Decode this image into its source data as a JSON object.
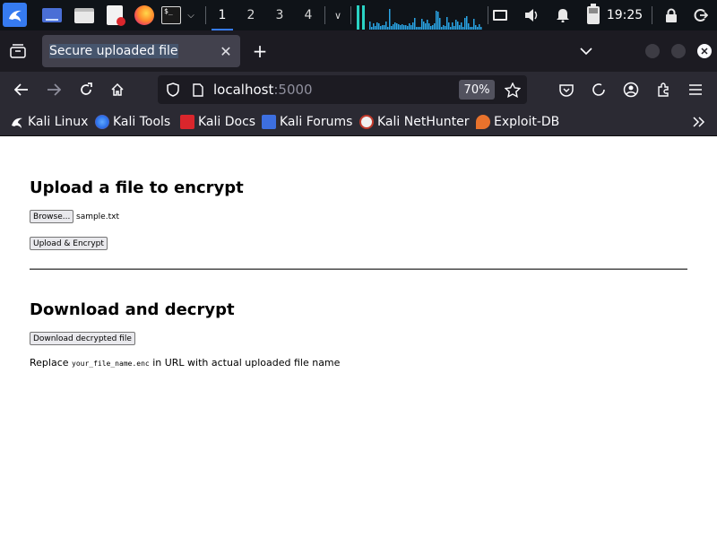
{
  "taskbar": {
    "workspaces": [
      "1",
      "2",
      "3",
      "4"
    ],
    "clock": "19:25"
  },
  "browser": {
    "tab_title": "Secure uploaded file",
    "url_host": "localhost",
    "url_port": ":5000",
    "zoom": "70%",
    "bookmarks": [
      "Kali Linux",
      "Kali Tools",
      "Kali Docs",
      "Kali Forums",
      "Kali NetHunter",
      "Exploit-DB"
    ]
  },
  "page": {
    "upload_heading": "Upload a file to encrypt",
    "browse_label": "Browse...",
    "selected_file": "sample.txt",
    "upload_button": "Upload & Encrypt",
    "download_heading": "Download and decrypt",
    "download_button": "Download decrypted file",
    "note_prefix": "Replace ",
    "note_code": "your_file_name.enc",
    "note_suffix": " in URL with actual uploaded file name"
  },
  "colors": {
    "kali_blue": "#367bf0",
    "cpu_graph": "#2aa5e6",
    "cpu_graph_accent": "#2ad3c4"
  }
}
